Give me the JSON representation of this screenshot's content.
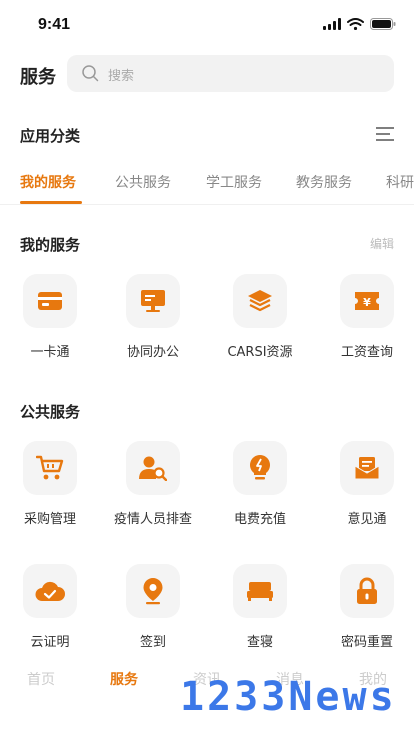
{
  "status_bar": {
    "time": "9:41"
  },
  "header": {
    "title": "服务",
    "search_placeholder": "搜索"
  },
  "categories": {
    "title": "应用分类"
  },
  "tabs": [
    {
      "label": "我的服务",
      "active": true
    },
    {
      "label": "公共服务",
      "active": false
    },
    {
      "label": "学工服务",
      "active": false
    },
    {
      "label": "教务服务",
      "active": false
    },
    {
      "label": "科研",
      "active": false
    }
  ],
  "my_services": {
    "title": "我的服务",
    "edit_label": "编辑",
    "items": [
      {
        "label": "一卡通",
        "icon": "card-icon"
      },
      {
        "label": "协同办公",
        "icon": "monitor-icon"
      },
      {
        "label": "CARSI资源",
        "icon": "layers-icon"
      },
      {
        "label": "工资查询",
        "icon": "yen-ticket-icon"
      }
    ]
  },
  "public_services": {
    "title": "公共服务",
    "items": [
      {
        "label": "采购管理",
        "icon": "cart-icon"
      },
      {
        "label": "疫情人员排查",
        "icon": "person-search-icon"
      },
      {
        "label": "电费充值",
        "icon": "bulb-icon"
      },
      {
        "label": "意见通",
        "icon": "mail-icon"
      },
      {
        "label": "云证明",
        "icon": "cloud-check-icon"
      },
      {
        "label": "签到",
        "icon": "location-pin-icon"
      },
      {
        "label": "查寝",
        "icon": "bed-icon"
      },
      {
        "label": "密码重置",
        "icon": "lock-icon"
      }
    ]
  },
  "bottom_nav": [
    {
      "label": "首页",
      "active": false
    },
    {
      "label": "服务",
      "active": true
    },
    {
      "label": "资讯",
      "active": false
    },
    {
      "label": "消息",
      "active": false
    },
    {
      "label": "我的",
      "active": false
    }
  ],
  "watermark": "1233News",
  "colors": {
    "accent": "#e7780f",
    "icon_bg": "#f4f4f4"
  }
}
